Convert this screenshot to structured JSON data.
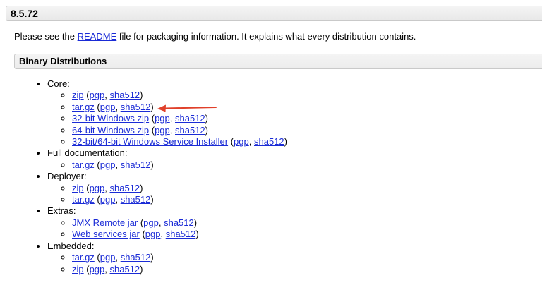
{
  "version_title": "8.5.72",
  "intro": {
    "before": "Please see the ",
    "link": "README",
    "after": " file for packaging information. It explains what every distribution contains."
  },
  "section_title": "Binary Distributions",
  "groups": [
    {
      "label": "Core:",
      "items": [
        {
          "main": "zip",
          "pgp": "pgp",
          "sha": "sha512"
        },
        {
          "main": "tar.gz",
          "pgp": "pgp",
          "sha": "sha512"
        },
        {
          "main": "32-bit Windows zip",
          "pgp": "pgp",
          "sha": "sha512"
        },
        {
          "main": "64-bit Windows zip",
          "pgp": "pgp",
          "sha": "sha512"
        },
        {
          "main": "32-bit/64-bit Windows Service Installer",
          "pgp": "pgp",
          "sha": "sha512"
        }
      ]
    },
    {
      "label": "Full documentation:",
      "items": [
        {
          "main": "tar.gz",
          "pgp": "pgp",
          "sha": "sha512"
        }
      ]
    },
    {
      "label": "Deployer:",
      "items": [
        {
          "main": "zip",
          "pgp": "pgp",
          "sha": "sha512"
        },
        {
          "main": "tar.gz",
          "pgp": "pgp",
          "sha": "sha512"
        }
      ]
    },
    {
      "label": "Extras:",
      "items": [
        {
          "main": "JMX Remote jar",
          "pgp": "pgp",
          "sha": "sha512"
        },
        {
          "main": "Web services jar",
          "pgp": "pgp",
          "sha": "sha512"
        }
      ]
    },
    {
      "label": "Embedded:",
      "items": [
        {
          "main": "tar.gz",
          "pgp": "pgp",
          "sha": "sha512"
        },
        {
          "main": "zip",
          "pgp": "pgp",
          "sha": "sha512"
        }
      ]
    }
  ],
  "colors": {
    "link": "#1a2bd6",
    "arrow": "#e0402a",
    "header_bg": "#eeeeee"
  },
  "icons": {
    "annotation": "red-arrow-icon"
  }
}
